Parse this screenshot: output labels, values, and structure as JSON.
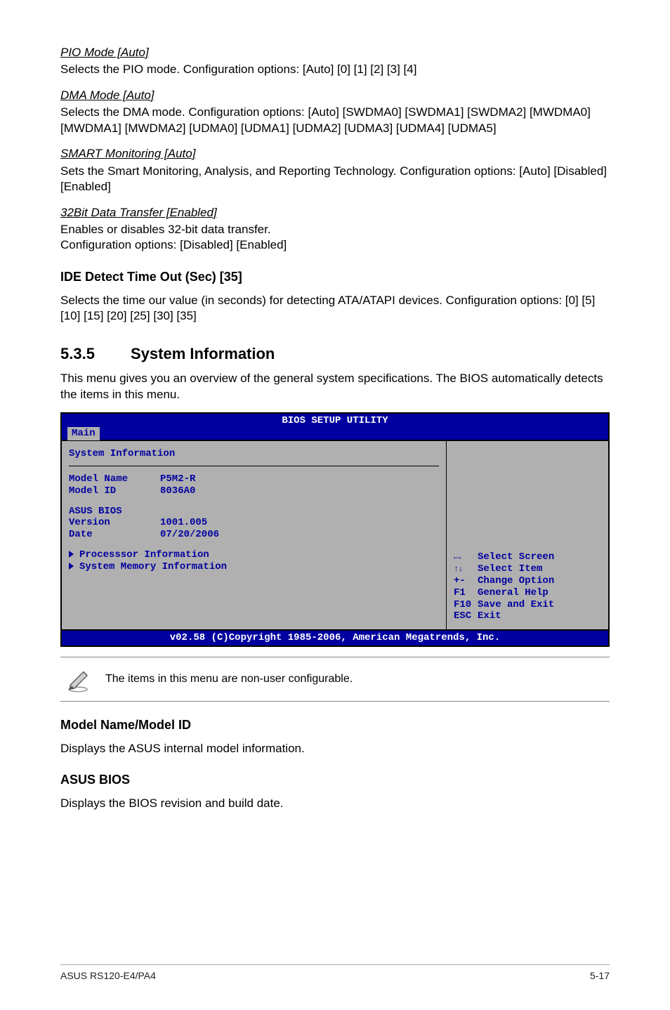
{
  "options": {
    "pio": {
      "title": "PIO Mode [Auto]",
      "desc": "Selects the PIO mode. Configuration options: [Auto] [0] [1] [2] [3] [4]"
    },
    "dma": {
      "title": "DMA Mode [Auto]",
      "desc": "Selects the DMA mode. Configuration options: [Auto] [SWDMA0] [SWDMA1] [SWDMA2] [MWDMA0] [MWDMA1] [MWDMA2] [UDMA0]  [UDMA1] [UDMA2] [UDMA3] [UDMA4] [UDMA5]"
    },
    "smart": {
      "title": "SMART Monitoring [Auto]",
      "desc": "Sets the Smart Monitoring, Analysis, and Reporting Technology. Configuration options: [Auto] [Disabled] [Enabled]"
    },
    "xfer32": {
      "title": "32Bit Data Transfer [Enabled]",
      "desc1": "Enables or disables 32-bit data transfer.",
      "desc2": "Configuration options: [Disabled] [Enabled]"
    }
  },
  "ide_detect": {
    "heading": "IDE Detect Time Out (Sec) [35]",
    "desc": "Selects the time our value (in seconds) for detecting ATA/ATAPI devices. Configuration options: [0] [5] [10] [15] [20] [25] [30] [35]"
  },
  "sysinfo_section": {
    "num": "5.3.5",
    "title": "System Information",
    "intro": "This menu gives you an overview of the general system specifications. The BIOS automatically detects the items in this menu."
  },
  "bios": {
    "top_title": "BIOS SETUP UTILITY",
    "tab": "Main",
    "panel_title": "System Information",
    "model_name_k": "Model Name",
    "model_name_v": "P5M2-R",
    "model_id_k": "Model ID",
    "model_id_v": "8036A0",
    "asus_bios": "ASUS BIOS",
    "version_k": "Version",
    "version_v": "1001.005",
    "date_k": "Date",
    "date_v": "07/20/2006",
    "sub_proc": "Processsor Information",
    "sub_mem": "System Memory Information",
    "help": {
      "sel_screen": "Select Screen",
      "sel_item": "Select Item",
      "change_option": "Change Option",
      "f1_label": "F1",
      "f1_text": "General Help",
      "f10_label": "F10",
      "f10_text": "Save and Exit",
      "esc_label": "ESC",
      "esc_text": "Exit"
    },
    "copyright": "v02.58 (C)Copyright 1985-2006, American Megatrends, Inc."
  },
  "note": {
    "text": "The items in this menu are non-user configurable."
  },
  "model_name_section": {
    "heading": "Model Name/Model ID",
    "desc": "Displays the ASUS internal model information."
  },
  "asus_bios_section": {
    "heading": "ASUS BIOS",
    "desc": "Displays the BIOS revision and build date."
  },
  "footer": {
    "left": "ASUS RS120-E4/PA4",
    "right": "5-17"
  }
}
